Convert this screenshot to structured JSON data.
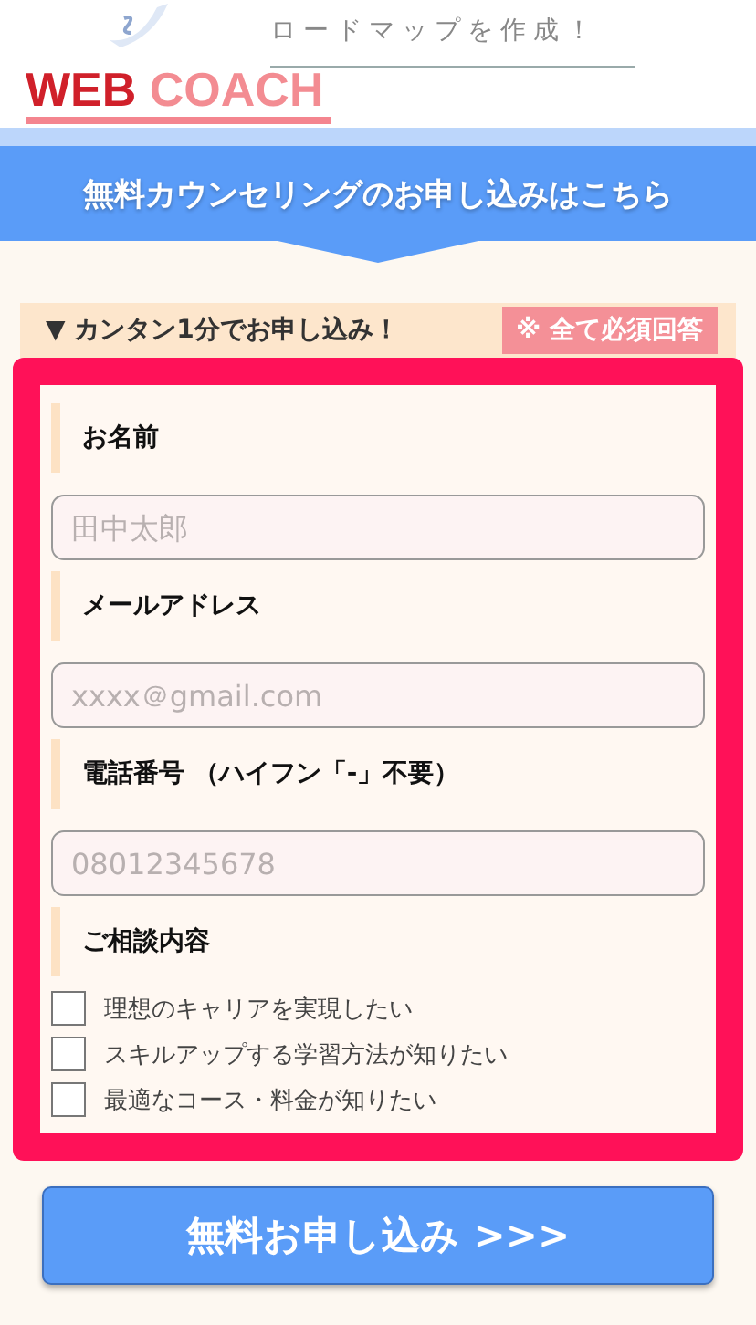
{
  "header": {
    "tagline": "ロードマップを作成！",
    "logo": {
      "first": "WEB",
      "second": "COACH"
    }
  },
  "banner": {
    "title": "無料カウンセリングのお申し込みはこちら"
  },
  "form_heading": {
    "title": "▼ カンタン1分でお申し込み！",
    "badge": "※ 全て必須回答"
  },
  "fields": [
    {
      "label": "お名前",
      "placeholder": "田中太郎"
    },
    {
      "label": "メールアドレス",
      "placeholder": "xxxx＠gmail.com"
    },
    {
      "label": "電話番号 （ハイフン「-」不要）",
      "placeholder": "08012345678"
    }
  ],
  "consultation": {
    "label": "ご相談内容",
    "options": [
      {
        "label": "理想のキャリアを実現したい",
        "checked": false
      },
      {
        "label": "スキルアップする学習方法が知りたい",
        "checked": false
      },
      {
        "label": "最適なコース・料金が知りたい",
        "checked": false
      }
    ]
  },
  "submit": {
    "label": "無料お申し込み >>>"
  }
}
